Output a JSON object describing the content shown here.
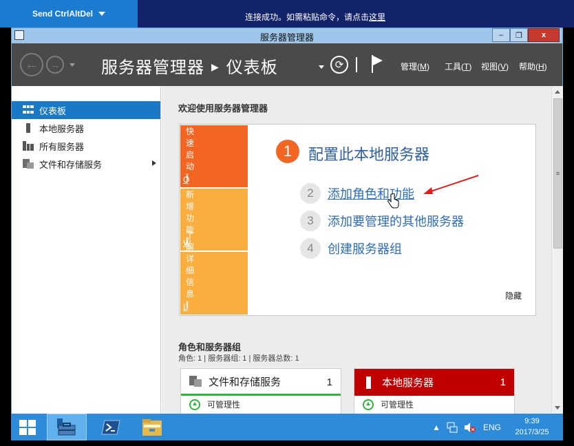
{
  "remote_bar": {
    "send_button": "Send CtrlAltDel",
    "message_prefix": "连接成功。如需粘贴命令，请点击",
    "message_link": "这里"
  },
  "window": {
    "title": "服务器管理器",
    "close_label": "x"
  },
  "nav": {
    "breadcrumb_root": "服务器管理器",
    "breadcrumb_current": "仪表板",
    "menus": [
      {
        "label": "管理(",
        "key": "M",
        "end": ")"
      },
      {
        "label": "工具(",
        "key": "T",
        "end": ")"
      },
      {
        "label": "视图(",
        "key": "V",
        "end": ")"
      },
      {
        "label": "帮助(",
        "key": "H",
        "end": ")"
      }
    ]
  },
  "sidebar": {
    "items": [
      {
        "label": "仪表板",
        "icon": "dashboard-icon",
        "active": true
      },
      {
        "label": "本地服务器",
        "icon": "server-icon"
      },
      {
        "label": "所有服务器",
        "icon": "servers-icon"
      },
      {
        "label": "文件和存储服务",
        "icon": "file-storage-icon"
      }
    ]
  },
  "welcome": {
    "title": "欢迎使用服务器管理器",
    "tiles": [
      {
        "label": "快速启动(",
        "key": "Q",
        "end": ")"
      },
      {
        "label": "新增功能(",
        "key": "W",
        "end": ")"
      },
      {
        "label": "了解详细信息(",
        "key": "L",
        "end": ")"
      }
    ],
    "step1": {
      "num": "1",
      "label": "配置此本地服务器"
    },
    "steps": [
      {
        "num": "2",
        "label": "添加角色和功能"
      },
      {
        "num": "3",
        "label": "添加要管理的其他服务器"
      },
      {
        "num": "4",
        "label": "创建服务器组"
      }
    ],
    "hide": "隐藏"
  },
  "roles": {
    "title": "角色和服务器组",
    "subtitle": "角色: 1 | 服务器组: 1 | 服务器总数: 1",
    "cards": [
      {
        "title": "文件和存储服务",
        "count": "1",
        "status": "可管理性"
      },
      {
        "title": "本地服务器",
        "count": "1",
        "status": "可管理性"
      }
    ]
  },
  "taskbar": {
    "lang": "ENG",
    "time": "9:39",
    "date": "2017/3/25"
  },
  "colors": {
    "accent": "#1a79c7",
    "quickstart": "#f26522",
    "tile": "#fbae40",
    "alert": "#c00000",
    "ok": "#2fb53c"
  }
}
